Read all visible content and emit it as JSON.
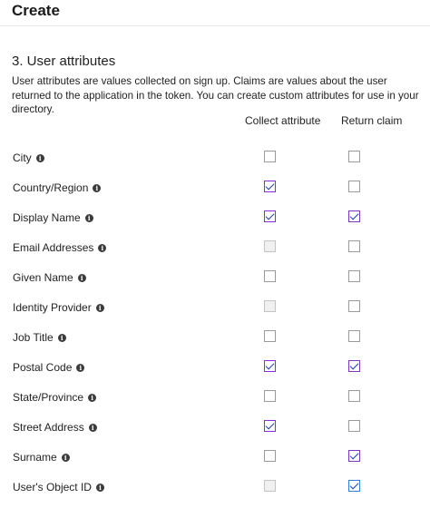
{
  "header": {
    "title": "Create"
  },
  "section": {
    "title": "3. User attributes",
    "description": "User attributes are values collected on sign up. Claims are values about the user returned to the application in the token. You can create custom attributes for use in your directory."
  },
  "columns": {
    "collect": "Collect attribute",
    "return": "Return claim"
  },
  "attributes": [
    {
      "label": "City",
      "collect": false,
      "collect_disabled": false,
      "return": false
    },
    {
      "label": "Country/Region",
      "collect": true,
      "collect_disabled": false,
      "return": false
    },
    {
      "label": "Display Name",
      "collect": true,
      "collect_disabled": false,
      "return": true
    },
    {
      "label": "Email Addresses",
      "collect": false,
      "collect_disabled": true,
      "return": false
    },
    {
      "label": "Given Name",
      "collect": false,
      "collect_disabled": false,
      "return": false
    },
    {
      "label": "Identity Provider",
      "collect": false,
      "collect_disabled": true,
      "return": false
    },
    {
      "label": "Job Title",
      "collect": false,
      "collect_disabled": false,
      "return": false
    },
    {
      "label": "Postal Code",
      "collect": true,
      "collect_disabled": false,
      "return": true
    },
    {
      "label": "State/Province",
      "collect": false,
      "collect_disabled": false,
      "return": false
    },
    {
      "label": "Street Address",
      "collect": true,
      "collect_disabled": false,
      "return": false
    },
    {
      "label": "Surname",
      "collect": false,
      "collect_disabled": false,
      "return": true
    },
    {
      "label": "User's Object ID",
      "collect": false,
      "collect_disabled": true,
      "return": true
    }
  ],
  "icons": {
    "info": "info-icon"
  },
  "colors": {
    "checked_border": "#8a2be2",
    "checkmark": "#1b3fa8",
    "disabled_fill": "#f0f0f0"
  }
}
